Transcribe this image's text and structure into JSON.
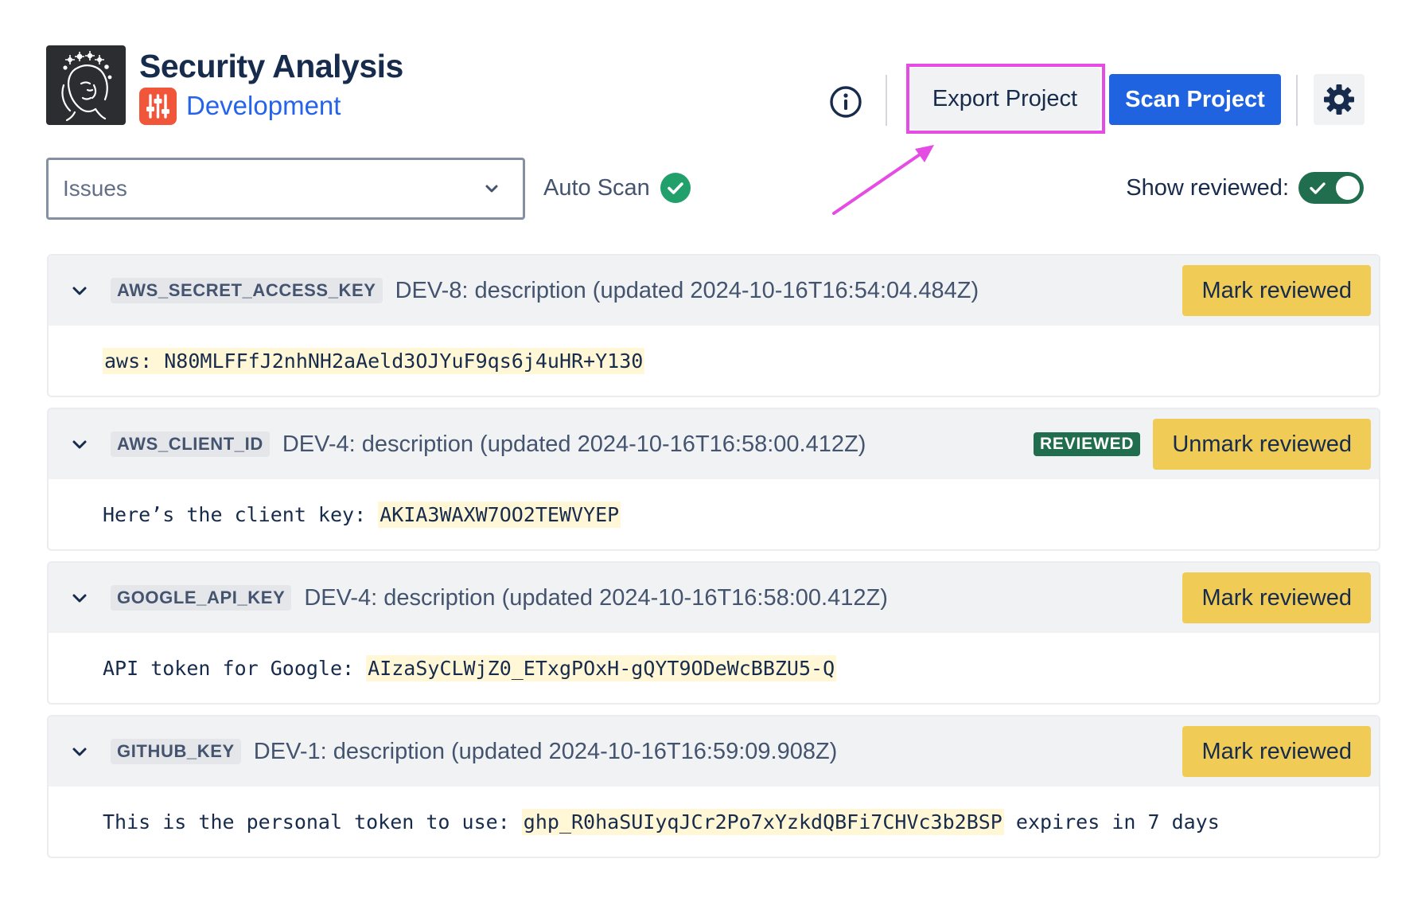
{
  "header": {
    "title": "Security Analysis",
    "project_name": "Development",
    "export_label": "Export Project",
    "scan_label": "Scan Project"
  },
  "icons": {
    "logo": "woman-face-logo-icon",
    "project": "sliders-icon",
    "info": "info-icon",
    "settings": "gear-icon",
    "chevron": "chevron-down-icon",
    "check": "check-icon"
  },
  "filters": {
    "view_select": "Issues",
    "auto_scan_label": "Auto Scan",
    "show_reviewed_label": "Show reviewed:",
    "show_reviewed_on": true
  },
  "colors": {
    "primary": "#1f63e0",
    "reviewed_green": "#216e4e",
    "mark_button": "#f0cb55",
    "highlight": "#e54ce3",
    "project_icon": "#f1553a"
  },
  "issues": [
    {
      "key": "AWS_SECRET_ACCESS_KEY",
      "description": "DEV-8: description (updated 2024-10-16T16:54:04.484Z)",
      "reviewed": false,
      "badge": "",
      "action": "Mark reviewed",
      "body_prefix": "",
      "secret": "aws: N80MLFFfJ2nhNH2aAeld3OJYuF9qs6j4uHR+Y130",
      "body_suffix": ""
    },
    {
      "key": "AWS_CLIENT_ID",
      "description": "DEV-4: description (updated 2024-10-16T16:58:00.412Z)",
      "reviewed": true,
      "badge": "REVIEWED",
      "action": "Unmark reviewed",
      "body_prefix": "Here’s the client key: ",
      "secret": "AKIA3WAXW7OO2TEWVYEP",
      "body_suffix": ""
    },
    {
      "key": "GOOGLE_API_KEY",
      "description": "DEV-4: description (updated 2024-10-16T16:58:00.412Z)",
      "reviewed": false,
      "badge": "",
      "action": "Mark reviewed",
      "body_prefix": "API token for Google: ",
      "secret": "AIzaSyCLWjZ0_ETxgPOxH-gQYT9ODeWcBBZU5-Q",
      "body_suffix": ""
    },
    {
      "key": "GITHUB_KEY",
      "description": "DEV-1: description (updated 2024-10-16T16:59:09.908Z)",
      "reviewed": false,
      "badge": "",
      "action": "Mark reviewed",
      "body_prefix": "This is the personal token to use: ",
      "secret": "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",
      "body_suffix": " expires in 7 days"
    }
  ]
}
